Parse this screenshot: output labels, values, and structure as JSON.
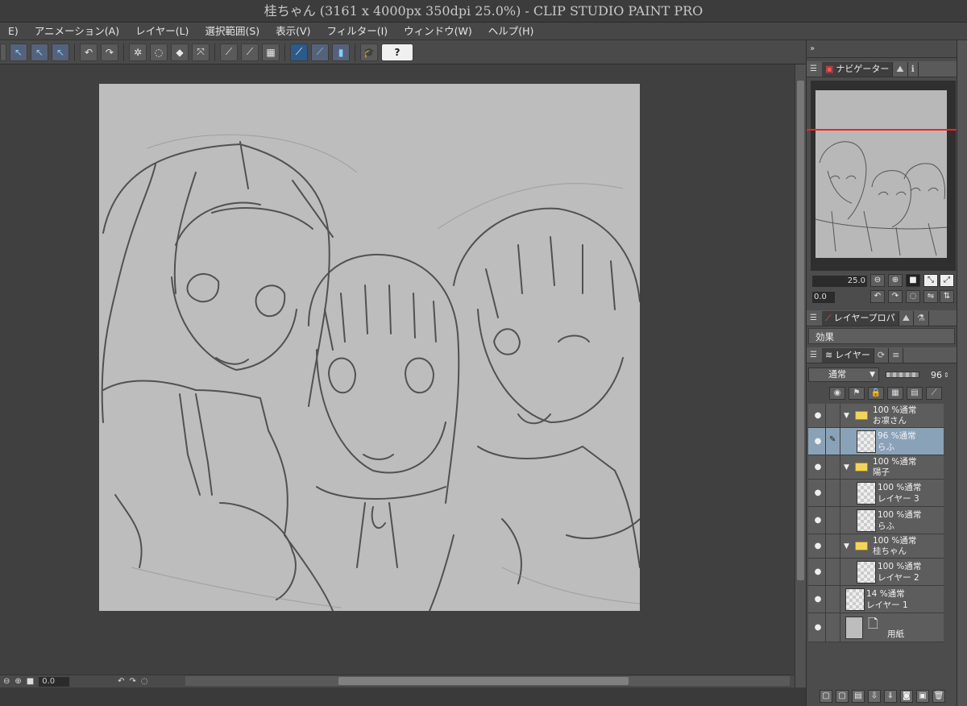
{
  "window": {
    "title": "桂ちゃん (3161 x 4000px 350dpi 25.0%)  - CLIP STUDIO PAINT PRO"
  },
  "menubar": {
    "items": [
      "E)",
      "アニメーション(A)",
      "レイヤー(L)",
      "選択範囲(S)",
      "表示(V)",
      "フィルター(I)",
      "ウィンドウ(W)",
      "ヘルプ(H)"
    ]
  },
  "toolbar": {
    "help_label": "?"
  },
  "statusbar": {
    "zoom_value": "0.0"
  },
  "navigator": {
    "tab_label": "ナビゲーター",
    "zoom_value": "25.0",
    "rotation_value": "0.0"
  },
  "layer_property": {
    "tab_label": "レイヤープロパ",
    "effect_label": "効果"
  },
  "layers_panel": {
    "tab_label": "レイヤー",
    "blend_mode": "通常",
    "opacity": "96",
    "layers": [
      {
        "mode": "100 %通常",
        "name": "お凛さん",
        "type": "folder"
      },
      {
        "mode": "96 %通常",
        "name": "らふ",
        "type": "raster",
        "selected": true
      },
      {
        "mode": "100 %通常",
        "name": "陽子",
        "type": "folder"
      },
      {
        "mode": "100 %通常",
        "name": "レイヤー 3",
        "type": "raster"
      },
      {
        "mode": "100 %通常",
        "name": "らふ",
        "type": "raster"
      },
      {
        "mode": "100 %通常",
        "name": "桂ちゃん",
        "type": "folder"
      },
      {
        "mode": "100 %通常",
        "name": "レイヤー 2",
        "type": "raster"
      },
      {
        "mode": "14 %通常",
        "name": "レイヤー 1",
        "type": "raster"
      },
      {
        "mode": "",
        "name": "用紙",
        "type": "paper"
      }
    ]
  },
  "colors": {
    "canvas_bg": "#404040",
    "paper": "#bdbdbd",
    "selected_layer": "#8aa2b8",
    "nav_red_line": "#ff2020"
  }
}
